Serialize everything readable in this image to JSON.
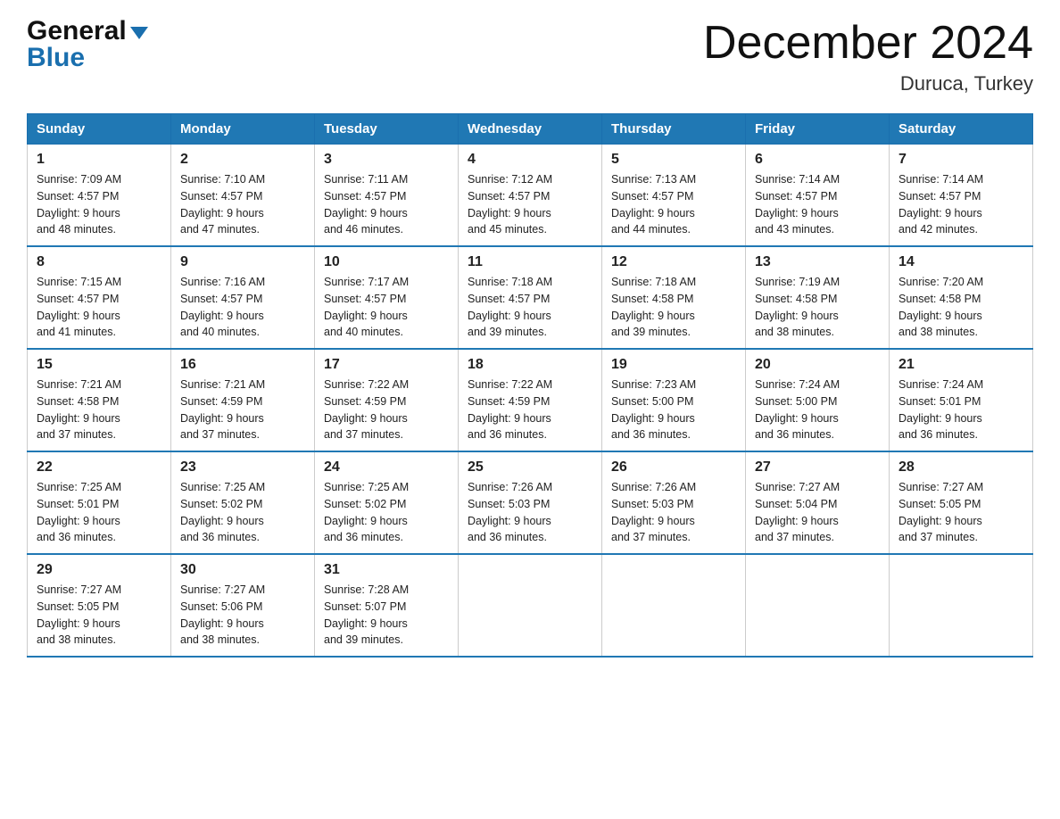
{
  "header": {
    "logo_general": "General",
    "logo_blue": "Blue",
    "month_title": "December 2024",
    "location": "Duruca, Turkey"
  },
  "days_of_week": [
    "Sunday",
    "Monday",
    "Tuesday",
    "Wednesday",
    "Thursday",
    "Friday",
    "Saturday"
  ],
  "weeks": [
    [
      {
        "num": "1",
        "sunrise": "7:09 AM",
        "sunset": "4:57 PM",
        "daylight": "9 hours and 48 minutes."
      },
      {
        "num": "2",
        "sunrise": "7:10 AM",
        "sunset": "4:57 PM",
        "daylight": "9 hours and 47 minutes."
      },
      {
        "num": "3",
        "sunrise": "7:11 AM",
        "sunset": "4:57 PM",
        "daylight": "9 hours and 46 minutes."
      },
      {
        "num": "4",
        "sunrise": "7:12 AM",
        "sunset": "4:57 PM",
        "daylight": "9 hours and 45 minutes."
      },
      {
        "num": "5",
        "sunrise": "7:13 AM",
        "sunset": "4:57 PM",
        "daylight": "9 hours and 44 minutes."
      },
      {
        "num": "6",
        "sunrise": "7:14 AM",
        "sunset": "4:57 PM",
        "daylight": "9 hours and 43 minutes."
      },
      {
        "num": "7",
        "sunrise": "7:14 AM",
        "sunset": "4:57 PM",
        "daylight": "9 hours and 42 minutes."
      }
    ],
    [
      {
        "num": "8",
        "sunrise": "7:15 AM",
        "sunset": "4:57 PM",
        "daylight": "9 hours and 41 minutes."
      },
      {
        "num": "9",
        "sunrise": "7:16 AM",
        "sunset": "4:57 PM",
        "daylight": "9 hours and 40 minutes."
      },
      {
        "num": "10",
        "sunrise": "7:17 AM",
        "sunset": "4:57 PM",
        "daylight": "9 hours and 40 minutes."
      },
      {
        "num": "11",
        "sunrise": "7:18 AM",
        "sunset": "4:57 PM",
        "daylight": "9 hours and 39 minutes."
      },
      {
        "num": "12",
        "sunrise": "7:18 AM",
        "sunset": "4:58 PM",
        "daylight": "9 hours and 39 minutes."
      },
      {
        "num": "13",
        "sunrise": "7:19 AM",
        "sunset": "4:58 PM",
        "daylight": "9 hours and 38 minutes."
      },
      {
        "num": "14",
        "sunrise": "7:20 AM",
        "sunset": "4:58 PM",
        "daylight": "9 hours and 38 minutes."
      }
    ],
    [
      {
        "num": "15",
        "sunrise": "7:21 AM",
        "sunset": "4:58 PM",
        "daylight": "9 hours and 37 minutes."
      },
      {
        "num": "16",
        "sunrise": "7:21 AM",
        "sunset": "4:59 PM",
        "daylight": "9 hours and 37 minutes."
      },
      {
        "num": "17",
        "sunrise": "7:22 AM",
        "sunset": "4:59 PM",
        "daylight": "9 hours and 37 minutes."
      },
      {
        "num": "18",
        "sunrise": "7:22 AM",
        "sunset": "4:59 PM",
        "daylight": "9 hours and 36 minutes."
      },
      {
        "num": "19",
        "sunrise": "7:23 AM",
        "sunset": "5:00 PM",
        "daylight": "9 hours and 36 minutes."
      },
      {
        "num": "20",
        "sunrise": "7:24 AM",
        "sunset": "5:00 PM",
        "daylight": "9 hours and 36 minutes."
      },
      {
        "num": "21",
        "sunrise": "7:24 AM",
        "sunset": "5:01 PM",
        "daylight": "9 hours and 36 minutes."
      }
    ],
    [
      {
        "num": "22",
        "sunrise": "7:25 AM",
        "sunset": "5:01 PM",
        "daylight": "9 hours and 36 minutes."
      },
      {
        "num": "23",
        "sunrise": "7:25 AM",
        "sunset": "5:02 PM",
        "daylight": "9 hours and 36 minutes."
      },
      {
        "num": "24",
        "sunrise": "7:25 AM",
        "sunset": "5:02 PM",
        "daylight": "9 hours and 36 minutes."
      },
      {
        "num": "25",
        "sunrise": "7:26 AM",
        "sunset": "5:03 PM",
        "daylight": "9 hours and 36 minutes."
      },
      {
        "num": "26",
        "sunrise": "7:26 AM",
        "sunset": "5:03 PM",
        "daylight": "9 hours and 37 minutes."
      },
      {
        "num": "27",
        "sunrise": "7:27 AM",
        "sunset": "5:04 PM",
        "daylight": "9 hours and 37 minutes."
      },
      {
        "num": "28",
        "sunrise": "7:27 AM",
        "sunset": "5:05 PM",
        "daylight": "9 hours and 37 minutes."
      }
    ],
    [
      {
        "num": "29",
        "sunrise": "7:27 AM",
        "sunset": "5:05 PM",
        "daylight": "9 hours and 38 minutes."
      },
      {
        "num": "30",
        "sunrise": "7:27 AM",
        "sunset": "5:06 PM",
        "daylight": "9 hours and 38 minutes."
      },
      {
        "num": "31",
        "sunrise": "7:28 AM",
        "sunset": "5:07 PM",
        "daylight": "9 hours and 39 minutes."
      },
      null,
      null,
      null,
      null
    ]
  ],
  "labels": {
    "sunrise": "Sunrise:",
    "sunset": "Sunset:",
    "daylight": "Daylight:"
  }
}
